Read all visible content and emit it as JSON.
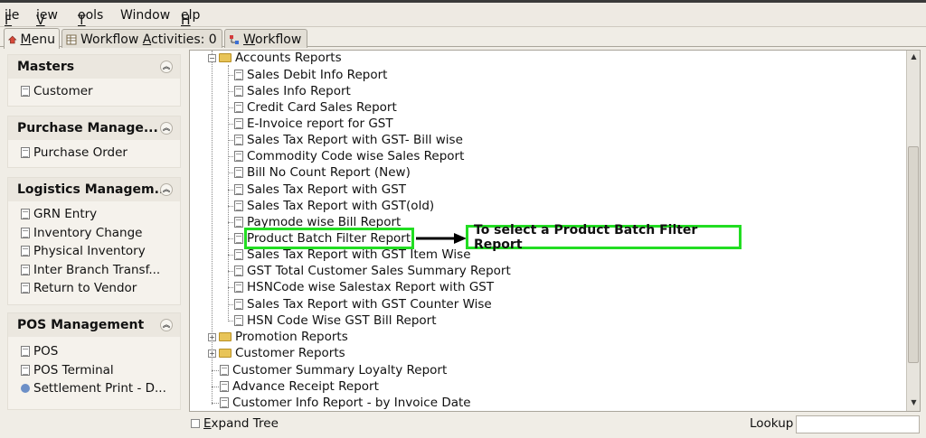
{
  "menubar": {
    "items": [
      {
        "accel": "F",
        "rest": "ile"
      },
      {
        "accel": "V",
        "rest": "iew"
      },
      {
        "accel": "T",
        "rest": "ools"
      },
      {
        "accel": "",
        "rest": "Window"
      },
      {
        "accel": "H",
        "rest": "elp"
      }
    ]
  },
  "tabs": {
    "menu": {
      "accel": "M",
      "rest": "enu"
    },
    "activities": {
      "pre": "Workflow ",
      "accel": "A",
      "rest": "ctivities: 0"
    },
    "workflow": {
      "accel": "W",
      "rest": "orkflow"
    }
  },
  "sidebar": {
    "masters": {
      "title": "Masters",
      "items": [
        "Customer"
      ]
    },
    "purchase": {
      "title": "Purchase Manage...",
      "items": [
        "Purchase Order"
      ]
    },
    "logistics": {
      "title": "Logistics Managem...",
      "items": [
        "GRN Entry",
        "Inventory Change",
        "Physical Inventory",
        "Inter Branch Transf...",
        "Return to Vendor"
      ]
    },
    "pos": {
      "title": "POS Management",
      "items": [
        "POS",
        "POS Terminal",
        "Settlement Print - D..."
      ]
    }
  },
  "tree": {
    "accounts_folder": "Accounts Reports",
    "reports": [
      "Sales Debit Info Report",
      "Sales Info Report",
      "Credit Card Sales Report",
      "E-Invoice report for GST",
      "Sales Tax Report with GST- Bill wise",
      "Commodity Code wise Sales Report",
      "Bill No Count Report (New)",
      "Sales Tax Report with GST",
      "Sales Tax Report with GST(old)",
      "Paymode wise Bill Report",
      "Product Batch Filter Report",
      "Sales Tax Report with GST Item Wise",
      "GST Total Customer Sales Summary Report",
      "HSNCode wise Salestax Report with GST",
      "Sales Tax Report with GST Counter Wise",
      "HSN Code Wise GST Bill Report"
    ],
    "promotion_folder": "Promotion Reports",
    "customer_folder": "Customer Reports",
    "root_items": [
      "Customer Summary Loyalty Report",
      "Advance Receipt Report",
      "Customer Info Report - by Invoice Date"
    ]
  },
  "callout": "To select a Product Batch Filter Report",
  "bottom": {
    "expand_tree": {
      "accel": "E",
      "rest": "xpand Tree"
    },
    "lookup": "Lookup"
  },
  "colors": {
    "highlight": "#22dd22",
    "arrow": "#000000"
  }
}
